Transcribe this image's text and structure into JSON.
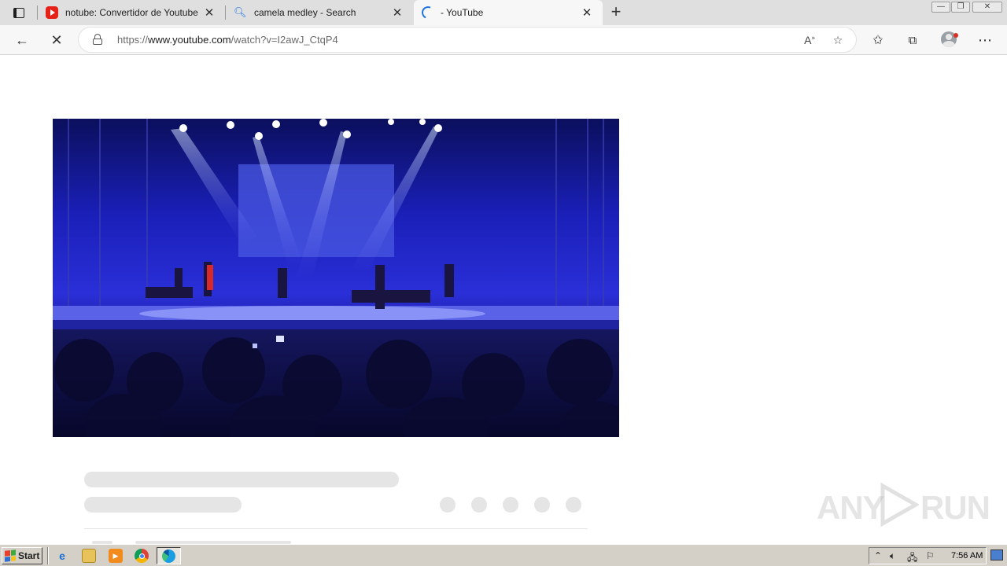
{
  "tabs": [
    {
      "title": "notube: Convertidor de Youtube",
      "favicon": "youtube-favicon",
      "active": false
    },
    {
      "title": "camela medley - Search",
      "favicon": "search-favicon",
      "active": false
    },
    {
      "title": " - YouTube",
      "favicon": "loading-spinner",
      "active": true
    }
  ],
  "address": {
    "scheme": "https://",
    "host": "www.youtube.com",
    "path": "/watch?v=I2awJ_CtqP4"
  },
  "colors": {
    "accent": "#1a73e8",
    "youtube_red": "#e62117",
    "skeleton": "#e5e5e5",
    "video_blue": "#2a2fd8"
  },
  "taskbar": {
    "start_label": "Start",
    "clock": "7:56 AM"
  },
  "watermark": {
    "left": "ANY",
    "right": "RUN"
  }
}
